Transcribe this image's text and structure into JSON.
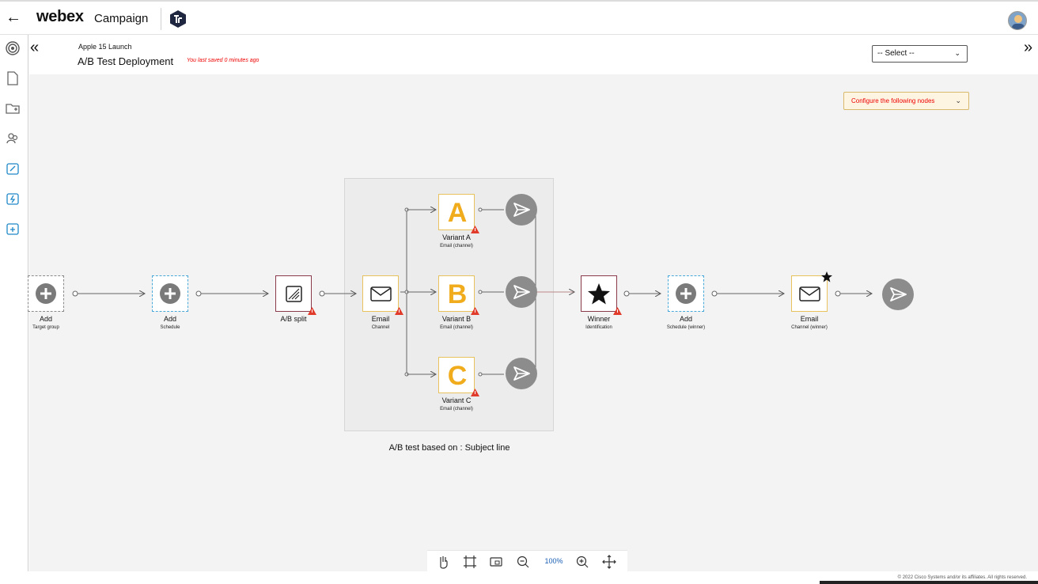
{
  "header": {
    "back_icon": "arrow-left-icon",
    "brand": "webex",
    "product": "Campaign",
    "org_logo_icon": "org-logo-icon",
    "avatar_icon": "user-avatar-icon"
  },
  "sidebar": {
    "items": [
      {
        "icon": "target-icon"
      },
      {
        "icon": "document-icon"
      },
      {
        "icon": "folder-add-icon"
      },
      {
        "icon": "audience-icon"
      },
      {
        "icon": "campaign-link-icon"
      },
      {
        "icon": "campaign-flash-icon"
      },
      {
        "icon": "campaign-add-icon"
      }
    ]
  },
  "subheader": {
    "breadcrumb": "Apple 15 Launch",
    "title": "A/B Test Deployment",
    "saved_status": "You last saved 0 minutes ago",
    "select_placeholder": "-- Select --"
  },
  "canvas": {
    "alert_label": "Configure the following nodes",
    "nodes": {
      "target_group": {
        "label": "Add",
        "sub": "Target group"
      },
      "schedule": {
        "label": "Add",
        "sub": "Schedule"
      },
      "ab_split": {
        "label": "A/B split"
      },
      "email_channel": {
        "label": "Email",
        "sub": "Channel"
      },
      "variant_a": {
        "letter": "A",
        "label": "Variant A",
        "sub": "Email (channel)"
      },
      "variant_b": {
        "letter": "B",
        "label": "Variant B",
        "sub": "Email (channel)"
      },
      "variant_c": {
        "letter": "C",
        "label": "Variant C",
        "sub": "Email (channel)"
      },
      "winner": {
        "label": "Winner",
        "sub": "Identification"
      },
      "schedule_winner": {
        "label": "Add",
        "sub": "Schedule (winner)"
      },
      "email_winner": {
        "label": "Email",
        "sub": "Channel (winner)"
      }
    },
    "group_caption": "A/B test based on : Subject line"
  },
  "toolbar": {
    "zoom": "100%",
    "icons": [
      "hand-icon",
      "fit-frame-icon",
      "minimap-icon",
      "zoom-out-icon",
      "zoom-in-icon",
      "move-icon"
    ]
  },
  "footer": {
    "copyright": "© 2022 Cisco Systems and/or its affiliates. All rights reserved."
  },
  "colors": {
    "variant_letter": "#f0ac1c",
    "warning": "#e03b2b",
    "alert_bg": "#fdf5e2",
    "send_button": "#8c8c8c"
  }
}
